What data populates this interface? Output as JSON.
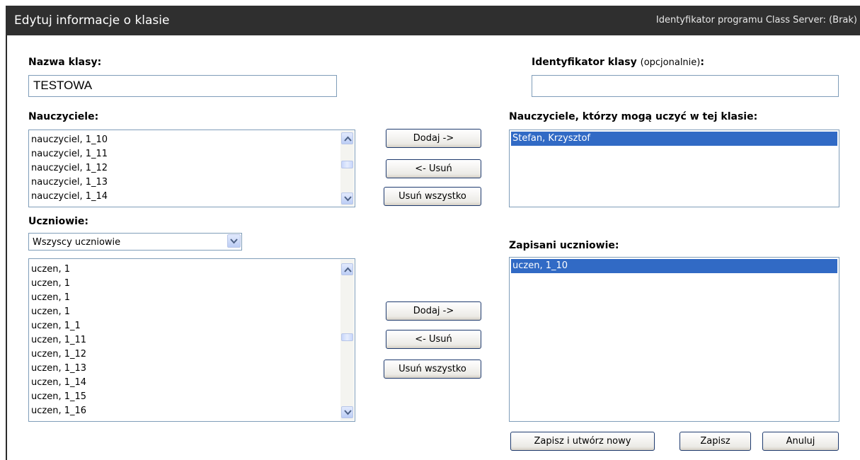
{
  "window": {
    "title": "Edytuj informacje o klasie",
    "program_id": "Identyfikator programu Class Server: (Brak)"
  },
  "class_name": {
    "label": "Nazwa klasy:",
    "value": "TESTOWA"
  },
  "class_id": {
    "label_bold": "Identyfikator klasy",
    "label_note": "(opcjonalnie)",
    "label_colon": ":",
    "value": ""
  },
  "teachers": {
    "label": "Nauczyciele:",
    "items": [
      "nauczyciel, 1_10",
      "nauczyciel, 1_11",
      "nauczyciel, 1_12",
      "nauczyciel, 1_13",
      "nauczyciel, 1_14"
    ]
  },
  "teacher_buttons": {
    "add": "Dodaj ->",
    "remove": "<- Usuń",
    "remove_all": "Usuń wszystko"
  },
  "assigned_teachers": {
    "label": "Nauczyciele, którzy mogą uczyć w tej klasie:",
    "items": [
      "Stefan, Krzysztof"
    ]
  },
  "students": {
    "label": "Uczniowie:",
    "filter": "Wszyscy uczniowie",
    "items": [
      "uczen, 1",
      "uczen, 1",
      "uczen, 1",
      "uczen, 1",
      "uczen, 1_1",
      "uczen, 1_11",
      "uczen, 1_12",
      "uczen, 1_13",
      "uczen, 1_14",
      "uczen, 1_15",
      "uczen, 1_16"
    ]
  },
  "student_buttons": {
    "add": "Dodaj ->",
    "remove": "<- Usuń",
    "remove_all": "Usuń wszystko"
  },
  "enrolled_students": {
    "label": "Zapisani uczniowie:",
    "items": [
      "uczen, 1_10"
    ]
  },
  "footer": {
    "save_new": "Zapisz i utwórz nowy",
    "save": "Zapisz",
    "cancel": "Anuluj"
  },
  "colors": {
    "titlebar": "#2f2f2f",
    "selection": "#316ac5",
    "border": "#7f9db9"
  },
  "icons": {
    "scroll_up": "chevron-up-icon",
    "scroll_down": "chevron-down-icon",
    "dropdown": "chevron-down-icon"
  }
}
